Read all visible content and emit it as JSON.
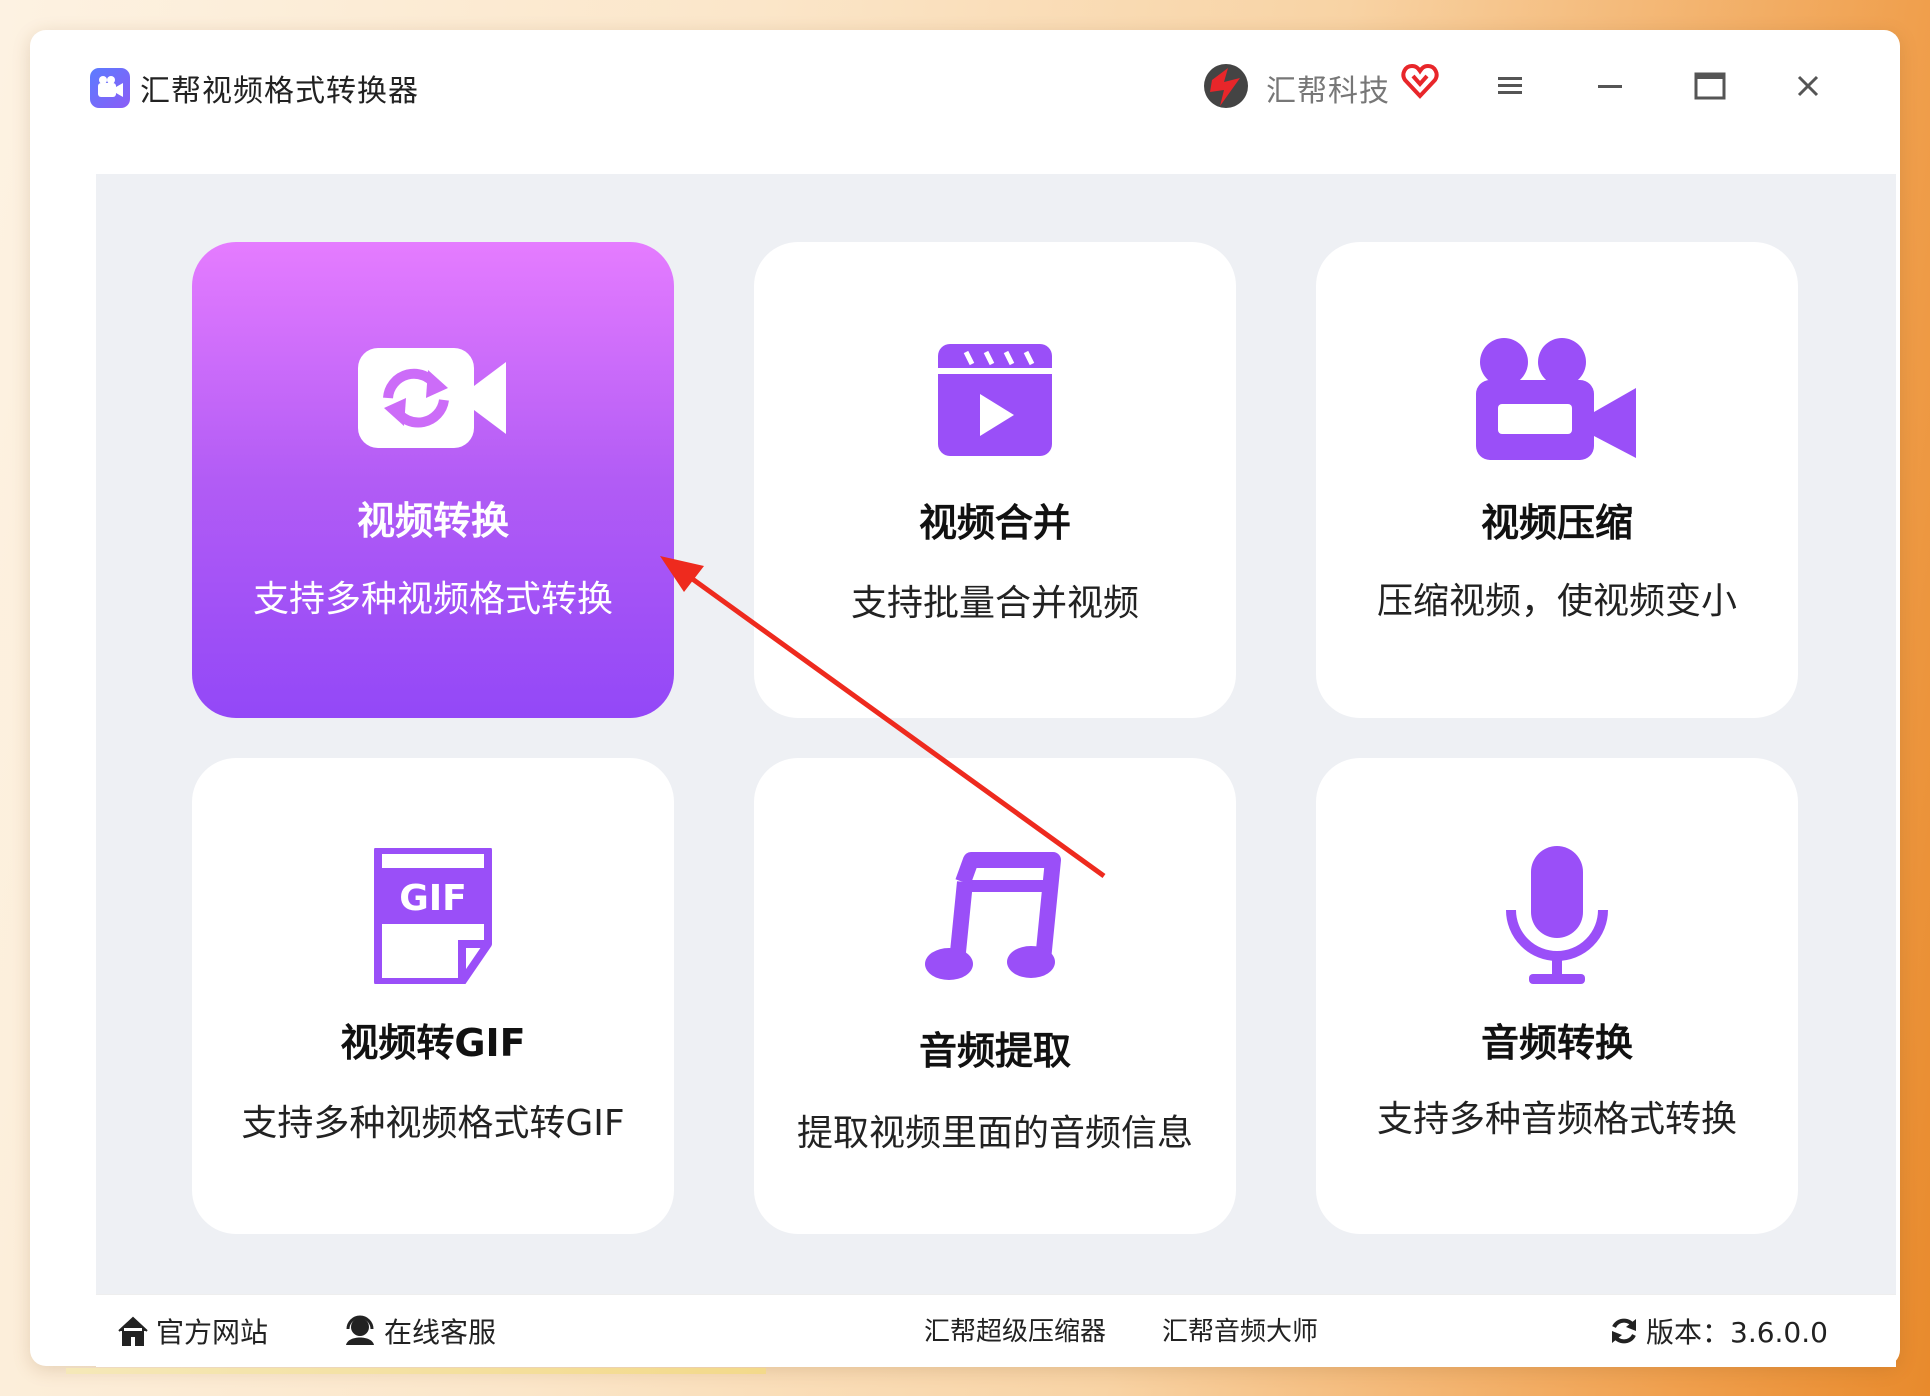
{
  "window": {
    "app_title": "汇帮视频格式转换器",
    "brand_name": "汇帮科技"
  },
  "cards": [
    {
      "icon": "video-convert-icon",
      "title": "视频转换",
      "desc": "支持多种视频格式转换",
      "active": true
    },
    {
      "icon": "clapperboard-icon",
      "title": "视频合并",
      "desc": "支持批量合并视频",
      "active": false
    },
    {
      "icon": "video-camera-icon",
      "title": "视频压缩",
      "desc": "压缩视频，使视频变小",
      "active": false
    },
    {
      "icon": "gif-file-icon",
      "title": "视频转GIF",
      "desc": "支持多种视频格式转GIF",
      "active": false
    },
    {
      "icon": "music-note-icon",
      "title": "音频提取",
      "desc": "提取视频里面的音频信息",
      "active": false
    },
    {
      "icon": "microphone-icon",
      "title": "音频转换",
      "desc": "支持多种音频格式转换",
      "active": false
    }
  ],
  "statusbar": {
    "official_site": "官方网站",
    "online_service": "在线客服",
    "compressor_link": "汇帮超级压缩器",
    "audio_master_link": "汇帮音频大师",
    "version": "版本：3.6.0.0"
  },
  "colors": {
    "accent_purple": "#9348f7",
    "card_gradient_top": "#e57cff",
    "arrow_red": "#ee2a1e"
  }
}
